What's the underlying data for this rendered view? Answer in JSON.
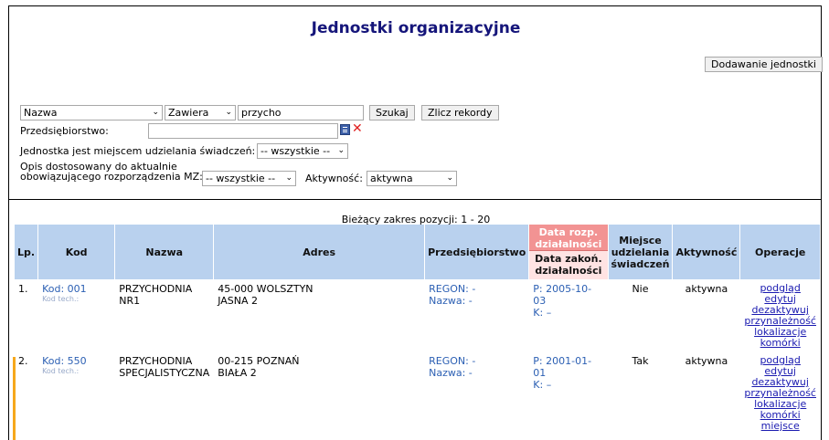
{
  "title": "Jednostki organizacyjne",
  "add_button": "Dodawanie jednostki",
  "filter": {
    "field": "Nazwa",
    "operator": "Zawiera",
    "query": "przycho",
    "search_button": "Szukaj",
    "count_button": "Zlicz rekordy",
    "enterprise_label": "Przedsiębiorstwo:",
    "enterprise_value": "",
    "place_label": "Jednostka jest miejscem udzielania świadczeń:",
    "place_value": "-- wszystkie --",
    "desc_label_1": "Opis dostosowany do aktualnie",
    "desc_label_2": "obowiązującego rozporządzenia MZ:",
    "desc_value": "-- wszystkie --",
    "activity_label": "Aktywność:",
    "activity_value": "aktywna"
  },
  "range_text": "Bieżący zakres pozycji: 1 - 20",
  "columns": {
    "lp": "Lp.",
    "kod": "Kod",
    "nazwa": "Nazwa",
    "adres": "Adres",
    "przeds": "Przedsiębiorstwo",
    "date_start": "Data rozp. działalności",
    "date_end": "Data zakoń. działalności",
    "miejsce": "Miejsce udzielania świadczeń",
    "aktywnosc": "Aktywność",
    "operacje": "Operacje"
  },
  "rows": [
    {
      "lp": "1.",
      "kod": "Kod: 001",
      "kod_tech": "Kod tech.: ",
      "nazwa_1": "PRZYCHODNIA",
      "nazwa_2": "NR1",
      "adres_1": "45-000 WOLSZTYN",
      "adres_2": "JASNA 2",
      "regon": "REGON: -",
      "nazwa_p": "Nazwa: -",
      "p": "P: 2005-10-03",
      "k": "K: –",
      "miejsce": "Nie",
      "aktywnosc": "aktywna",
      "ops": [
        "podgląd",
        "edytuj",
        "dezaktywuj",
        "przynależność",
        "lokalizacje",
        "komórki"
      ]
    },
    {
      "lp": "2.",
      "kod": "Kod: 550",
      "kod_tech": "Kod tech.: ",
      "nazwa_1": "PRZYCHODNIA",
      "nazwa_2": "SPECJALISTYCZNA",
      "adres_1": "00-215 POZNAŃ",
      "adres_2": "BIAŁA 2",
      "regon": "REGON: -",
      "nazwa_p": "Nazwa: -",
      "p": "P: 2001-01-01",
      "k": "K: –",
      "miejsce": "Tak",
      "aktywnosc": "aktywna",
      "ops": [
        "podgląd",
        "edytuj",
        "dezaktywuj",
        "przynależność",
        "lokalizacje",
        "komórki",
        "miejsce"
      ]
    }
  ]
}
